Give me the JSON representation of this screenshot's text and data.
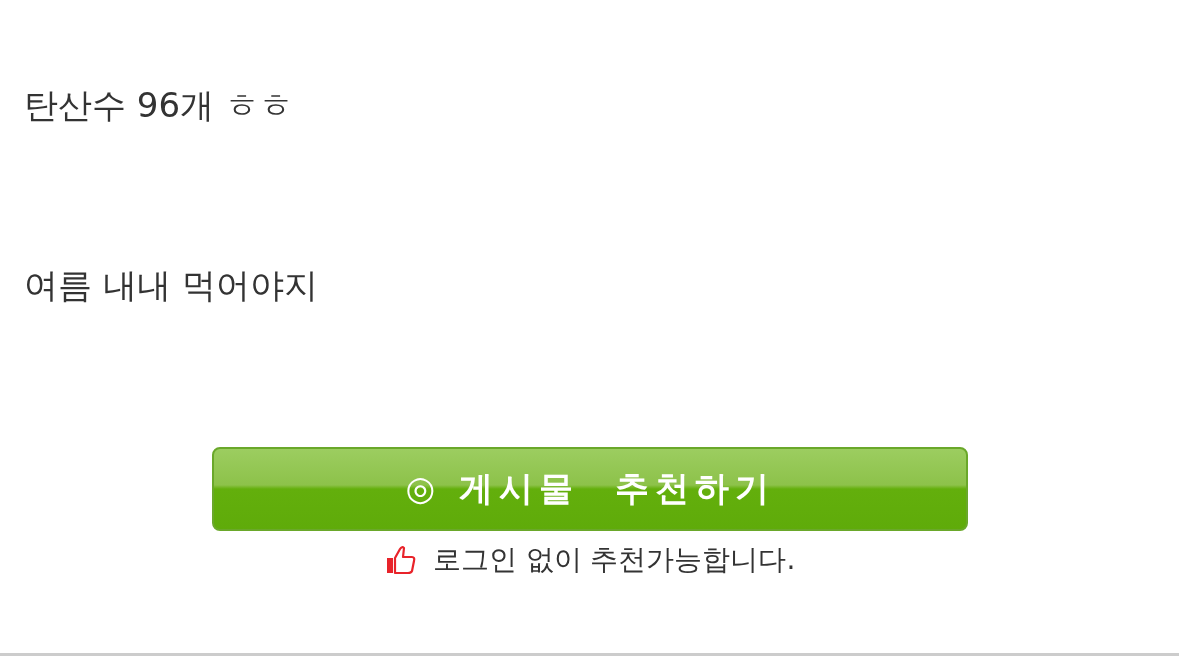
{
  "post": {
    "paragraphs": [
      "탄산수 96개 ㅎㅎ",
      "여름 내내 먹어야지"
    ]
  },
  "recommend": {
    "button": "◎ 게시물  추천하기",
    "note": "로그인 없이 추천가능합니다."
  }
}
